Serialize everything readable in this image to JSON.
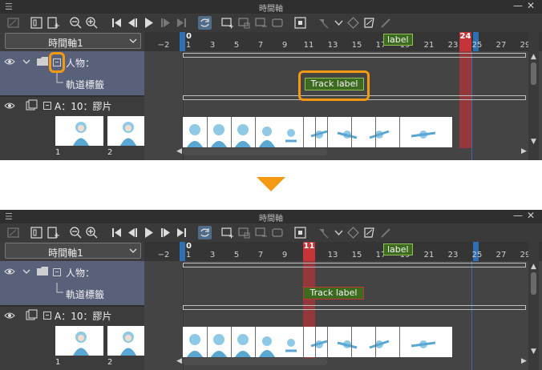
{
  "window_title": "時間軸",
  "timeline_select": "時間軸1",
  "layers": {
    "folder": "人物：",
    "track": "軌道標籤",
    "animation": "A：10：膠片"
  },
  "cell_numbers": [
    "1",
    "2"
  ],
  "ruler_labels": [
    "−2",
    "0",
    "1",
    "3",
    "5",
    "7",
    "9",
    "11",
    "13",
    "15",
    "17",
    "19",
    "21",
    "23",
    "25",
    "27",
    "29"
  ],
  "top_state": {
    "current_frame_label": "24",
    "ruler_label_text": "label",
    "track_label_text": "Track label"
  },
  "bottom_state": {
    "current_frame_label": "11",
    "ruler_label_text": "label",
    "track_label_text": "Track label"
  },
  "colors": {
    "highlight": "#f39a12",
    "current_frame": "#c6343a",
    "label_green": "#3c6b1f",
    "selected_layer": "#58607a"
  }
}
